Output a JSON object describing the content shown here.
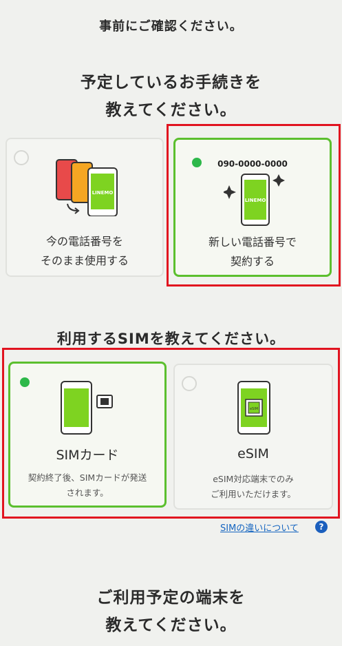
{
  "top_note": "事前にご確認ください。",
  "procedure": {
    "title_line1": "予定しているお手続きを",
    "title_line2": "教えてください。",
    "options": [
      {
        "line1": "今の電話番号を",
        "line2": "そのまま使用する",
        "selected": false,
        "phone_brand": "LINEMO"
      },
      {
        "line1": "新しい電話番号で",
        "line2": "契約する",
        "selected": true,
        "phone_number": "090-0000-0000",
        "phone_brand": "LINEMO"
      }
    ]
  },
  "sim": {
    "title": "利用するSIMを教えてください。",
    "options": [
      {
        "label": "SIMカード",
        "sub1": "契約終了後、SIMカードが発送",
        "sub2": "されます。",
        "selected": true
      },
      {
        "label": "eSIM",
        "sub1": "eSIM対応端末でのみ",
        "sub2": "ご利用いただけます。",
        "selected": false,
        "chip_text": "eSIM"
      }
    ],
    "help_link": "SIMの違いについて",
    "help_icon_glyph": "?"
  },
  "device": {
    "title_line1": "ご利用予定の端末を",
    "title_line2": "教えてください。"
  },
  "colors": {
    "accent_green": "#2db84a",
    "phone_screen_green": "#7ed321",
    "highlight_red": "#e1131f",
    "link_blue": "#1565c0"
  }
}
